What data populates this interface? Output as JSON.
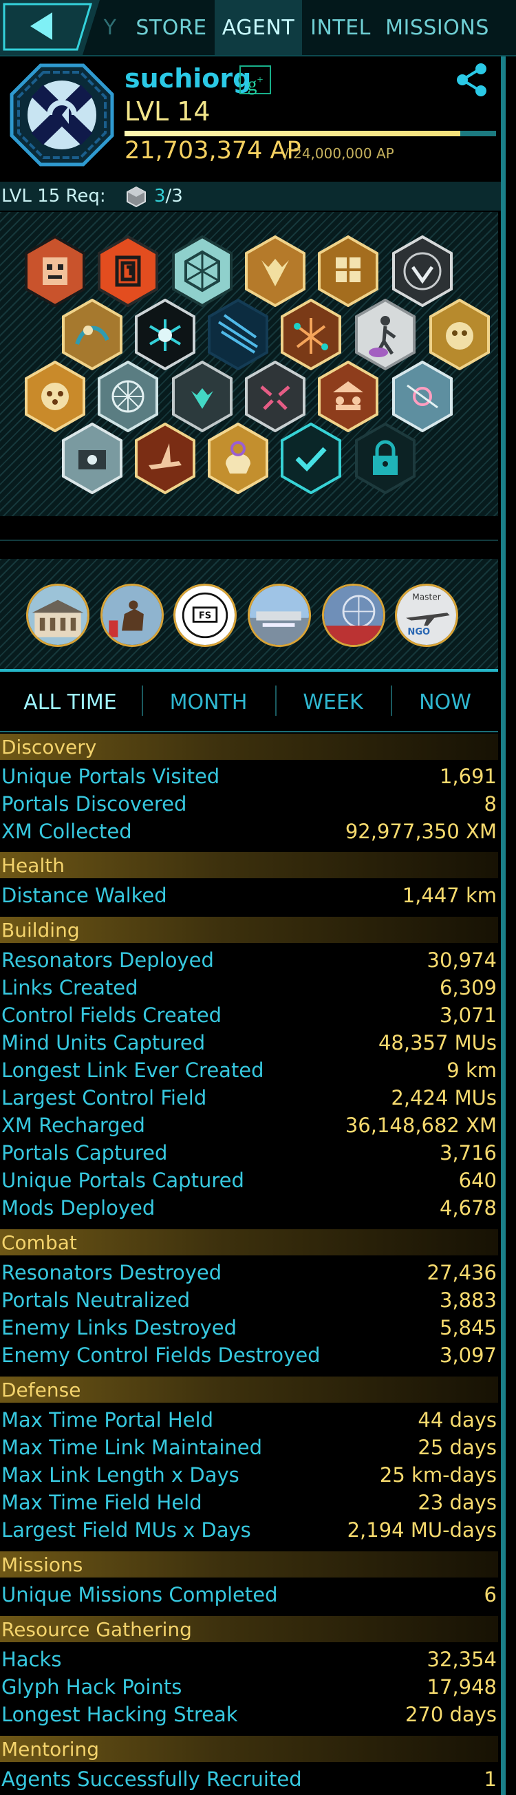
{
  "nav": {
    "partial_tab": "Y",
    "tabs": [
      "STORE",
      "AGENT",
      "INTEL",
      "MISSIONS"
    ],
    "active_tab": "AGENT"
  },
  "colors": {
    "accent": "#2bc9e6",
    "gold": "#f6da6e",
    "section_bg": "#6e5716",
    "rail": "#1a7f89"
  },
  "profile": {
    "name": "suchiorg",
    "level": "LVL 14",
    "ap": "21,703,374 AP",
    "ap_max": "/ 24,000,000 AP",
    "ap_progress": 0.904,
    "icons": {
      "badge": "faction-badge-icon",
      "social": "google-plus-icon",
      "share": "share-icon"
    }
  },
  "requirement": {
    "label": "LVL 15 Req:",
    "have": "3",
    "need": "/3"
  },
  "missions_visible": {
    "master_label": "Master",
    "ngo_label": "NGO"
  },
  "period_tabs": [
    "ALL TIME",
    "MONTH",
    "WEEK",
    "NOW"
  ],
  "stats": [
    {
      "section": "Discovery",
      "rows": [
        {
          "label": "Unique Portals Visited",
          "value": "1,691"
        },
        {
          "label": "Portals Discovered",
          "value": "8"
        },
        {
          "label": "XM Collected",
          "value": "92,977,350 XM"
        }
      ]
    },
    {
      "section": "Health",
      "rows": [
        {
          "label": "Distance Walked",
          "value": "1,447 km"
        }
      ]
    },
    {
      "section": "Building",
      "rows": [
        {
          "label": "Resonators Deployed",
          "value": "30,974"
        },
        {
          "label": "Links Created",
          "value": "6,309"
        },
        {
          "label": "Control Fields Created",
          "value": "3,071"
        },
        {
          "label": "Mind Units Captured",
          "value": "48,357 MUs"
        },
        {
          "label": "Longest Link Ever Created",
          "value": "9 km"
        },
        {
          "label": "Largest Control Field",
          "value": "2,424 MUs"
        },
        {
          "label": "XM Recharged",
          "value": "36,148,682 XM"
        },
        {
          "label": "Portals Captured",
          "value": "3,716"
        },
        {
          "label": "Unique Portals Captured",
          "value": "640"
        },
        {
          "label": "Mods Deployed",
          "value": "4,678"
        }
      ]
    },
    {
      "section": "Combat",
      "rows": [
        {
          "label": "Resonators Destroyed",
          "value": "27,436"
        },
        {
          "label": "Portals Neutralized",
          "value": "3,883"
        },
        {
          "label": "Enemy Links Destroyed",
          "value": "5,845"
        },
        {
          "label": "Enemy Control Fields Destroyed",
          "value": "3,097"
        }
      ]
    },
    {
      "section": "Defense",
      "rows": [
        {
          "label": "Max Time Portal Held",
          "value": "44 days"
        },
        {
          "label": "Max Time Link Maintained",
          "value": "25 days"
        },
        {
          "label": "Max Link Length x Days",
          "value": "25 km-days"
        },
        {
          "label": "Max Time Field Held",
          "value": "23 days"
        },
        {
          "label": "Largest Field MUs x Days",
          "value": "2,194 MU-days"
        }
      ]
    },
    {
      "section": "Missions",
      "rows": [
        {
          "label": "Unique Missions Completed",
          "value": "6"
        }
      ]
    },
    {
      "section": "Resource Gathering",
      "rows": [
        {
          "label": "Hacks",
          "value": "32,354"
        },
        {
          "label": "Glyph Hack Points",
          "value": "17,948"
        },
        {
          "label": "Longest Hacking Streak",
          "value": "270 days"
        }
      ]
    },
    {
      "section": "Mentoring",
      "rows": [
        {
          "label": "Agents Successfully Recruited",
          "value": "1"
        }
      ]
    }
  ]
}
